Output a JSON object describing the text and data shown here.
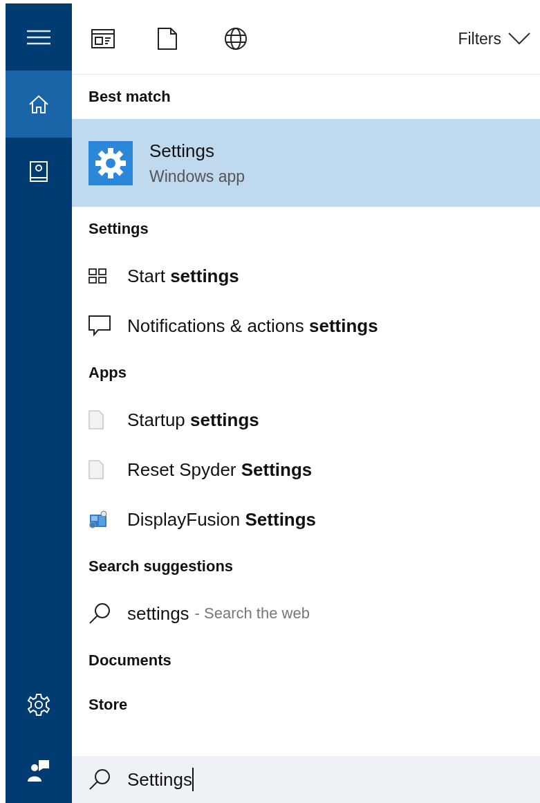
{
  "sidebar": {
    "items": [
      {
        "kind": "menu",
        "selected": false
      },
      {
        "kind": "home",
        "selected": true
      },
      {
        "kind": "notebook",
        "selected": false
      }
    ],
    "bottom_items": [
      {
        "kind": "settings"
      },
      {
        "kind": "feedback"
      }
    ]
  },
  "filter_bar": {
    "scopes": [
      {
        "kind": "apps"
      },
      {
        "kind": "documents"
      },
      {
        "kind": "web"
      }
    ],
    "filters_label": "Filters"
  },
  "sections": [
    {
      "heading": "Best match",
      "results": [
        {
          "kind": "best",
          "title": "Settings",
          "subtitle": "Windows app",
          "selected": true
        }
      ]
    },
    {
      "heading": "Settings",
      "results": [
        {
          "kind": "tiles",
          "text": "Start **settings**"
        },
        {
          "kind": "notification",
          "text": "Notifications & actions **settings**"
        }
      ]
    },
    {
      "heading": "Apps",
      "results": [
        {
          "kind": "file",
          "text": "Startup **settings**"
        },
        {
          "kind": "file",
          "text": "Reset Spyder **Settings**"
        },
        {
          "kind": "displayfusion",
          "text": "DisplayFusion **Settings**"
        }
      ]
    },
    {
      "heading": "Search suggestions",
      "results": [
        {
          "kind": "web",
          "text": "settings",
          "hint": "- Search the web"
        }
      ]
    },
    {
      "heading": "Documents"
    },
    {
      "heading": "Store"
    }
  ],
  "search": {
    "value": "Settings"
  }
}
